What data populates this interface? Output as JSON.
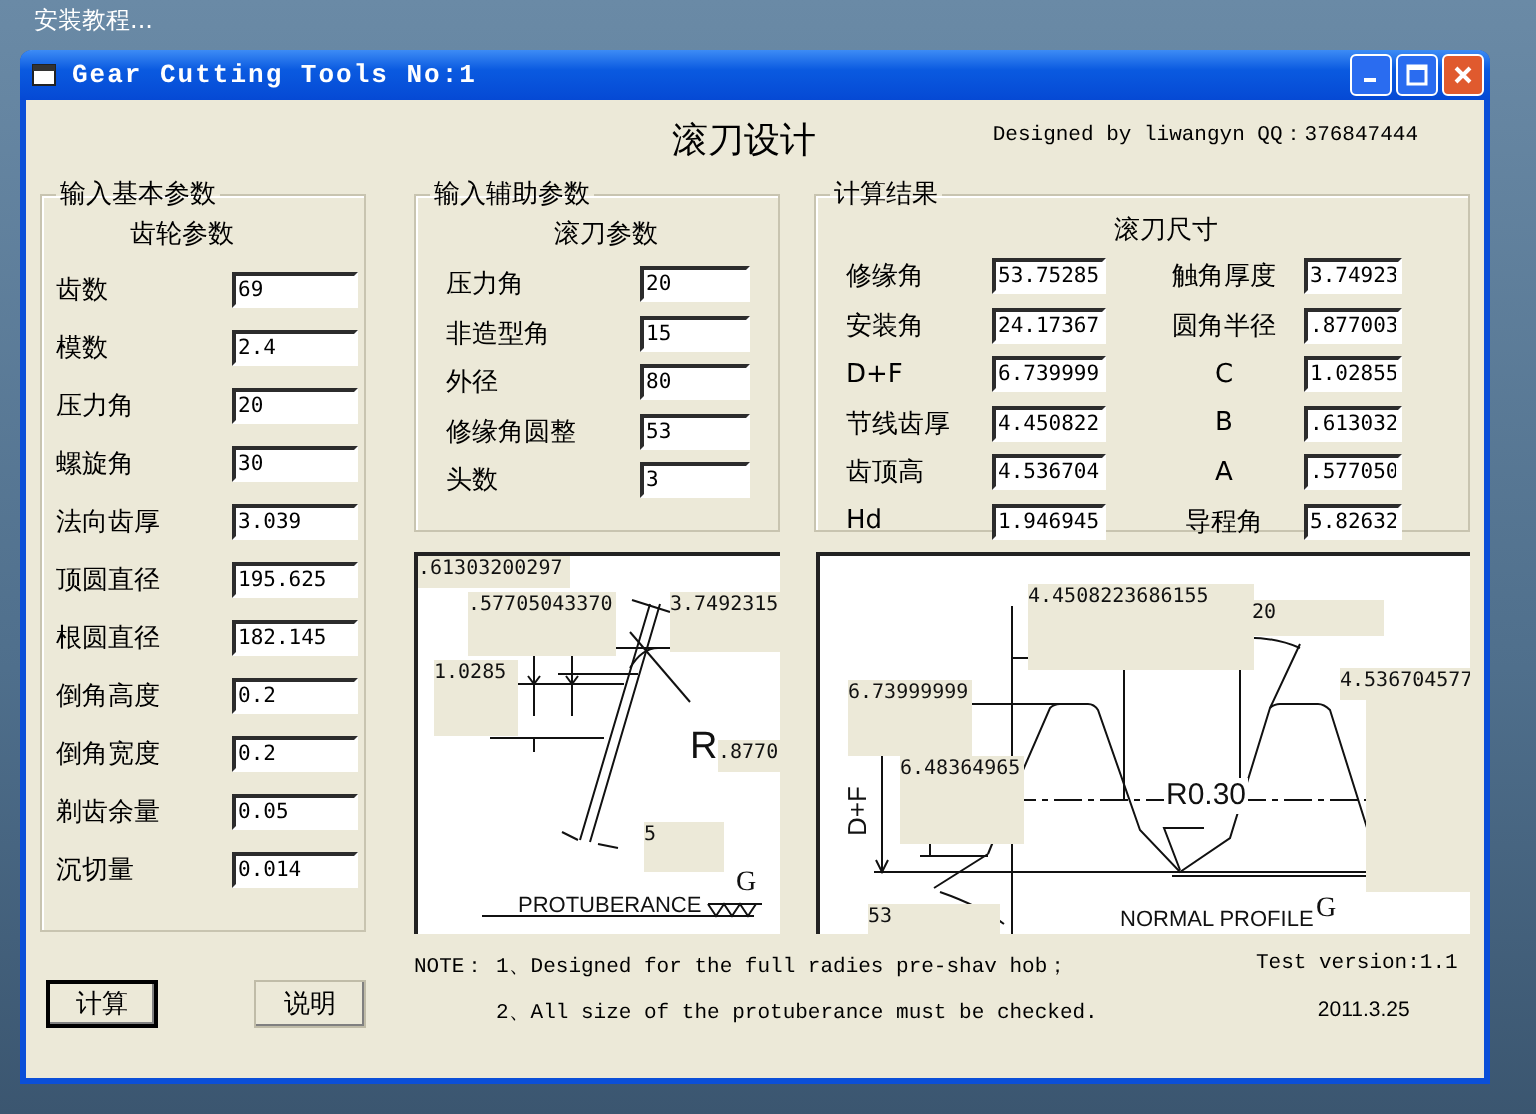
{
  "desktop": {
    "text": "安装教程..."
  },
  "window": {
    "title": "Gear Cutting Tools No:1"
  },
  "heading": "滚刀设计",
  "credit": "Designed by liwangyn  QQ：376847444",
  "basic_params": {
    "legend": "输入基本参数",
    "subheading": "齿轮参数",
    "fields": [
      {
        "label": "齿数",
        "value": "69"
      },
      {
        "label": "模数",
        "value": "2.4"
      },
      {
        "label": "压力角",
        "value": "20"
      },
      {
        "label": "螺旋角",
        "value": "30"
      },
      {
        "label": "法向齿厚",
        "value": "3.039"
      },
      {
        "label": "顶圆直径",
        "value": "195.625"
      },
      {
        "label": "根圆直径",
        "value": "182.145"
      },
      {
        "label": "倒角高度",
        "value": "0.2"
      },
      {
        "label": "倒角宽度",
        "value": "0.2"
      },
      {
        "label": "剃齿余量",
        "value": "0.05"
      },
      {
        "label": "沉切量",
        "value": "0.014"
      }
    ]
  },
  "aux_params": {
    "legend": "输入辅助参数",
    "subheading": "滚刀参数",
    "fields": [
      {
        "label": "压力角",
        "value": "20"
      },
      {
        "label": "非造型角",
        "value": "15"
      },
      {
        "label": "外径",
        "value": "80"
      },
      {
        "label": "修缘角圆整",
        "value": "53"
      },
      {
        "label": "头数",
        "value": "3"
      }
    ]
  },
  "results": {
    "legend": "计算结果",
    "subheading": "滚刀尺寸",
    "fields": [
      {
        "label": "修缘角",
        "value": "53.75285"
      },
      {
        "label": "触角厚度",
        "value": "3.74923"
      },
      {
        "label": "安装角",
        "value": "24.17367"
      },
      {
        "label": "圆角半径",
        "value": ".877003"
      },
      {
        "label": "D+F",
        "value": "6.739999"
      },
      {
        "label": "C",
        "value": "1.02855"
      },
      {
        "label": "节线齿厚",
        "value": "4.450822"
      },
      {
        "label": "B",
        "value": ".613032"
      },
      {
        "label": "齿顶高",
        "value": "4.536704"
      },
      {
        "label": "A",
        "value": ".577050"
      },
      {
        "label": "Hd",
        "value": "1.946945"
      },
      {
        "label": "导程角",
        "value": "5.82632"
      }
    ]
  },
  "protuberance_drawing": {
    "labels": [
      ".61303200297",
      ".57705043370",
      "3.7492315",
      "1.0285",
      "R",
      ".8770",
      "5",
      "PROTUBERANCE",
      "G"
    ]
  },
  "profile_drawing": {
    "labels": [
      "4.4508223686155",
      "20",
      "4.536704577",
      "6.73999999",
      "6.48364965",
      "D+F",
      "R0.30",
      "53",
      "NORMAL PROFILE",
      "G"
    ]
  },
  "notes": {
    "prefix": "NOTE：",
    "lines": [
      "1、Designed for the full radies pre-shav hob；",
      "2、All size of the protuberance must be checked."
    ]
  },
  "version": "Test version:1.1",
  "date": "2011.3.25",
  "buttons": [
    {
      "label": "计算",
      "default": true
    },
    {
      "label": "说明",
      "default": false
    }
  ]
}
